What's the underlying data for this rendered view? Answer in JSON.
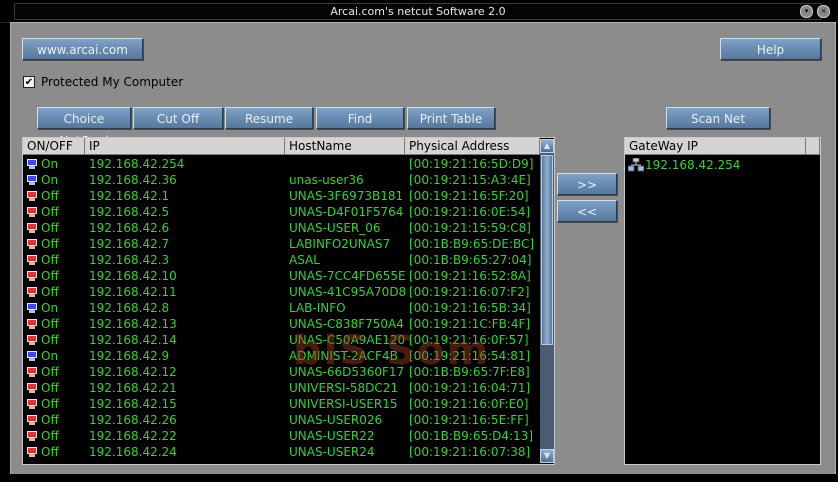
{
  "window": {
    "title": "Arcai.com's netcut Software 2.0"
  },
  "toolbar": {
    "website_label": "www.arcai.com",
    "help_label": "Help",
    "protect_label": "Protected My Computer",
    "protect_checked": "✔",
    "choice_netcard": "Choice NetCard",
    "cut_off": "Cut Off",
    "resume": "Resume",
    "find": "Find",
    "print_table": "Print Table",
    "scan_net": "Scan Net",
    "add_gateway": ">>",
    "remove_gateway": "<<"
  },
  "hosts": {
    "columns": [
      "ON/OFF",
      "IP",
      "HostName",
      "Physical Address"
    ],
    "rows": [
      {
        "status": "On",
        "ip": "192.168.42.254",
        "host": "",
        "mac": "[00:19:21:16:5D:D9]"
      },
      {
        "status": "On",
        "ip": "192.168.42.36",
        "host": "unas-user36",
        "mac": "[00:19:21:15:A3:4E]"
      },
      {
        "status": "Off",
        "ip": "192.168.42.1",
        "host": "UNAS-3F6973B181",
        "mac": "[00:19:21:16:5F:20]"
      },
      {
        "status": "Off",
        "ip": "192.168.42.5",
        "host": "UNAS-D4F01F5764",
        "mac": "[00:19:21:16:0E:54]"
      },
      {
        "status": "Off",
        "ip": "192.168.42.6",
        "host": "UNAS-USER_06",
        "mac": "[00:19:21:15:59:C8]"
      },
      {
        "status": "Off",
        "ip": "192.168.42.7",
        "host": "LABINFO2UNAS7",
        "mac": "[00:1B:B9:65:DE:BC]"
      },
      {
        "status": "Off",
        "ip": "192.168.42.3",
        "host": "ASAL",
        "mac": "[00:1B:B9:65:27:04]"
      },
      {
        "status": "Off",
        "ip": "192.168.42.10",
        "host": "UNAS-7CC4FD655E",
        "mac": "[00:19:21:16:52:8A]"
      },
      {
        "status": "Off",
        "ip": "192.168.42.11",
        "host": "UNAS-41C95A70D8",
        "mac": "[00:19:21:16:07:F2]"
      },
      {
        "status": "On",
        "ip": "192.168.42.8",
        "host": "LAB-INFO",
        "mac": "[00:19:21:16:5B:34]"
      },
      {
        "status": "Off",
        "ip": "192.168.42.13",
        "host": "UNAS-C838F750A4",
        "mac": "[00:19:21:1C:FB:4F]"
      },
      {
        "status": "Off",
        "ip": "192.168.42.14",
        "host": "UNAS-C50A9AE120",
        "mac": "[00:19:21:16:0F:57]"
      },
      {
        "status": "On",
        "ip": "192.168.42.9",
        "host": "ADMINIST-2ACF4B",
        "mac": "[00:19:21:16:54:81]"
      },
      {
        "status": "Off",
        "ip": "192.168.42.12",
        "host": "UNAS-66D5360F17",
        "mac": "[00:1B:B9:65:7F:E8]"
      },
      {
        "status": "Off",
        "ip": "192.168.42.21",
        "host": "UNIVERSI-58DC21",
        "mac": "[00:19:21:16:04:71]"
      },
      {
        "status": "Off",
        "ip": "192.168.42.15",
        "host": "UNIVERSI-USER15",
        "mac": "[00:19:21:16:0F:E0]"
      },
      {
        "status": "Off",
        "ip": "192.168.42.26",
        "host": "UNAS-USER026",
        "mac": "[00:19:21:16:5E:FF]"
      },
      {
        "status": "Off",
        "ip": "192.168.42.22",
        "host": "UNAS-USER22",
        "mac": "[00:1B:B9:65:D4:13]"
      },
      {
        "status": "Off",
        "ip": "192.168.42.24",
        "host": "UNAS-USER24",
        "mac": "[00:19:21:16:07:38]"
      }
    ]
  },
  "gateway": {
    "column": "GateWay IP",
    "rows": [
      {
        "ip": "192.168.42.254"
      }
    ]
  },
  "watermark": "blS Som",
  "colors": {
    "on_icon": "#3a4bff",
    "off_icon": "#e53030",
    "text_green": "#35d235",
    "button_blue": "#6a8fb4",
    "panel_gray": "#8c8c8c"
  },
  "icons": {
    "host_status": "computer-icon",
    "gateway": "network-icon",
    "scroll_up": "up-arrow-icon",
    "scroll_down": "down-arrow-icon"
  }
}
